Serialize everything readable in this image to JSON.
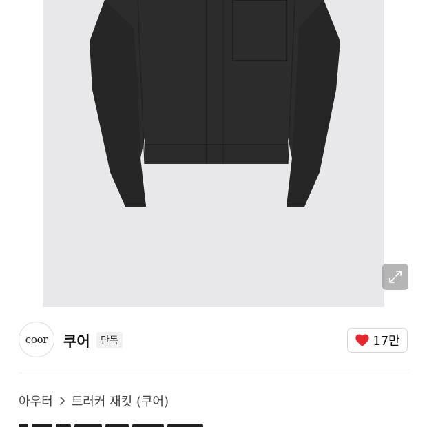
{
  "product_image": {
    "alt": "",
    "background": "#e8e8ea",
    "garment_color": "#2c2c2c"
  },
  "expand_button": {
    "icon": "expand-icon"
  },
  "brand": {
    "logo_text": "coor",
    "name": "쿠어",
    "badge": "단독"
  },
  "like": {
    "icon": "heart-icon",
    "color": "#e8262d",
    "count": "17만"
  },
  "breadcrumb": {
    "category": "아우터",
    "separator_icon": "chevron-right-icon",
    "subcategory": "트러커 재킷 (쿠어)"
  }
}
